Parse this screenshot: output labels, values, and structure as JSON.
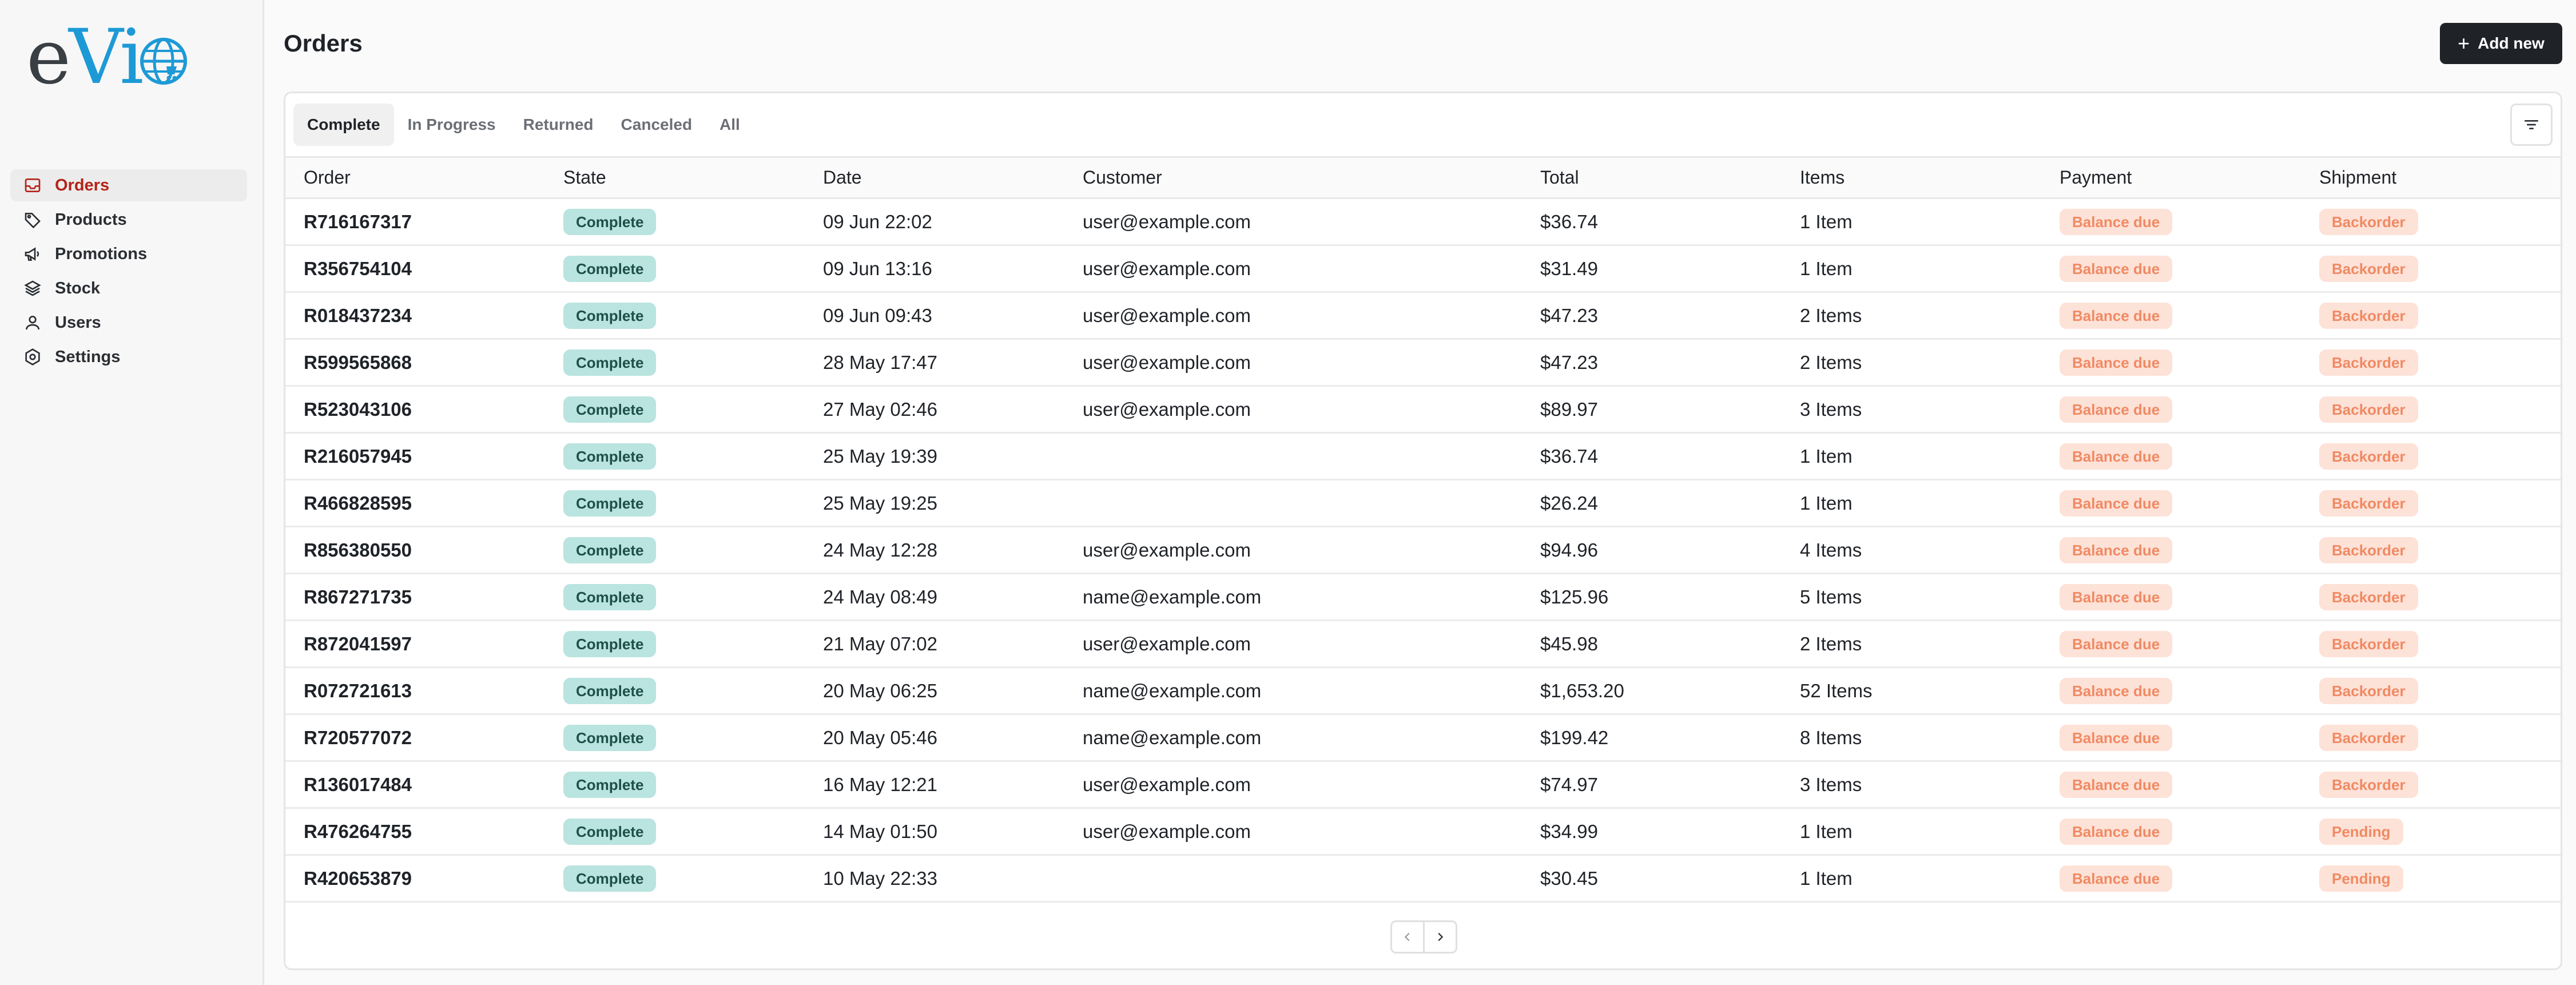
{
  "brand": {
    "logo_text_e": "e",
    "logo_text_vi": "Vi",
    "accent_color": "#1d9ad6"
  },
  "sidebar": {
    "items": [
      {
        "label": "Orders",
        "icon": "inbox-icon",
        "active": true
      },
      {
        "label": "Products",
        "icon": "tag-icon",
        "active": false
      },
      {
        "label": "Promotions",
        "icon": "megaphone-icon",
        "active": false
      },
      {
        "label": "Stock",
        "icon": "layers-icon",
        "active": false
      },
      {
        "label": "Users",
        "icon": "user-icon",
        "active": false
      },
      {
        "label": "Settings",
        "icon": "gear-icon",
        "active": false
      }
    ],
    "active_color": "#b42318"
  },
  "header": {
    "title": "Orders",
    "add_label": "Add new"
  },
  "tabs": [
    {
      "label": "Complete",
      "active": true
    },
    {
      "label": "In Progress",
      "active": false
    },
    {
      "label": "Returned",
      "active": false
    },
    {
      "label": "Canceled",
      "active": false
    },
    {
      "label": "All",
      "active": false
    }
  ],
  "table": {
    "columns": [
      "Order",
      "State",
      "Date",
      "Customer",
      "Total",
      "Items",
      "Payment",
      "Shipment"
    ],
    "rows": [
      [
        "R716167317",
        "Complete",
        "09 Jun 22:02",
        "user@example.com",
        "$36.74",
        "1 Item",
        "Balance due",
        "Backorder"
      ],
      [
        "R356754104",
        "Complete",
        "09 Jun 13:16",
        "user@example.com",
        "$31.49",
        "1 Item",
        "Balance due",
        "Backorder"
      ],
      [
        "R018437234",
        "Complete",
        "09 Jun 09:43",
        "user@example.com",
        "$47.23",
        "2 Items",
        "Balance due",
        "Backorder"
      ],
      [
        "R599565868",
        "Complete",
        "28 May 17:47",
        "user@example.com",
        "$47.23",
        "2 Items",
        "Balance due",
        "Backorder"
      ],
      [
        "R523043106",
        "Complete",
        "27 May 02:46",
        "user@example.com",
        "$89.97",
        "3 Items",
        "Balance due",
        "Backorder"
      ],
      [
        "R216057945",
        "Complete",
        "25 May 19:39",
        "",
        "$36.74",
        "1 Item",
        "Balance due",
        "Backorder"
      ],
      [
        "R466828595",
        "Complete",
        "25 May 19:25",
        "",
        "$26.24",
        "1 Item",
        "Balance due",
        "Backorder"
      ],
      [
        "R856380550",
        "Complete",
        "24 May 12:28",
        "user@example.com",
        "$94.96",
        "4 Items",
        "Balance due",
        "Backorder"
      ],
      [
        "R867271735",
        "Complete",
        "24 May 08:49",
        "name@example.com",
        "$125.96",
        "5 Items",
        "Balance due",
        "Backorder"
      ],
      [
        "R872041597",
        "Complete",
        "21 May 07:02",
        "user@example.com",
        "$45.98",
        "2 Items",
        "Balance due",
        "Backorder"
      ],
      [
        "R072721613",
        "Complete",
        "20 May 06:25",
        "name@example.com",
        "$1,653.20",
        "52 Items",
        "Balance due",
        "Backorder"
      ],
      [
        "R720577072",
        "Complete",
        "20 May 05:46",
        "name@example.com",
        "$199.42",
        "8 Items",
        "Balance due",
        "Backorder"
      ],
      [
        "R136017484",
        "Complete",
        "16 May 12:21",
        "user@example.com",
        "$74.97",
        "3 Items",
        "Balance due",
        "Backorder"
      ],
      [
        "R476264755",
        "Complete",
        "14 May 01:50",
        "user@example.com",
        "$34.99",
        "1 Item",
        "Balance due",
        "Pending"
      ],
      [
        "R420653879",
        "Complete",
        "10 May 22:33",
        "",
        "$30.45",
        "1 Item",
        "Balance due",
        "Pending"
      ]
    ]
  },
  "pagination": {
    "prev_icon": "chevron-left-icon",
    "next_icon": "chevron-right-icon"
  }
}
